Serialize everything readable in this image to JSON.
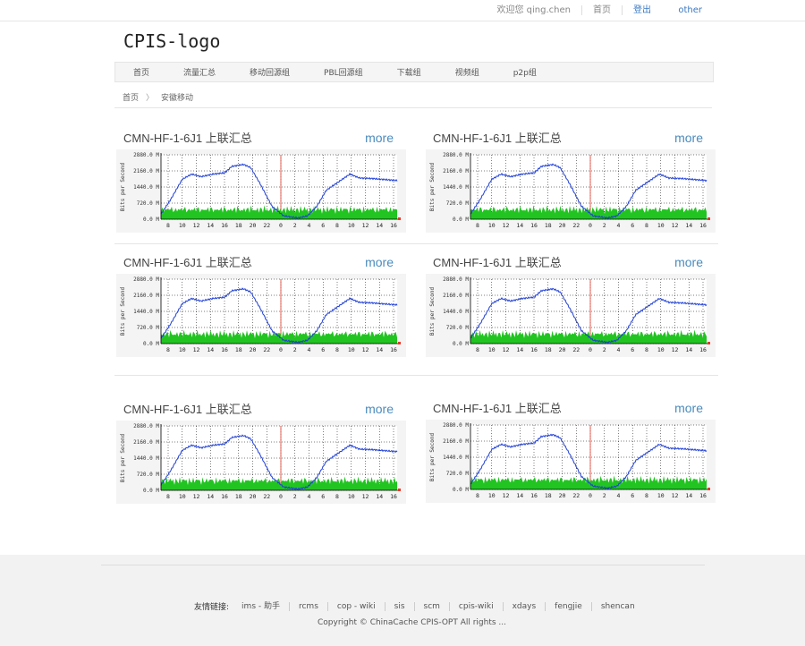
{
  "topbar": {
    "welcome": "欢迎您 qing.chen",
    "home": "首页",
    "logout": "登出",
    "other": "other"
  },
  "logo": "CPIS-logo",
  "nav": [
    "首页",
    "流量汇总",
    "移动回源组",
    "PBL回源组",
    "下载组",
    "视频组",
    "p2p组"
  ],
  "breadcrumb": {
    "home": "首页",
    "sep": "〉",
    "current": "安徽移动"
  },
  "panels": [
    {
      "title": "CMN-HF-1-6J1 上联汇总",
      "more": "more",
      "ytop": "2880.0 M",
      "yticks": [
        "2880.0 M",
        "2160.0 M",
        "1440.0 M",
        "720.0 M",
        "0.0 M"
      ],
      "xticks": [
        "8",
        "10",
        "12",
        "14",
        "16",
        "18",
        "20",
        "22",
        "0",
        "2",
        "4",
        "6",
        "8",
        "10",
        "12",
        "14",
        "16"
      ]
    },
    {
      "title": "CMN-HF-1-6J1 上联汇总",
      "more": "more",
      "yticks": [
        "2880.0 M",
        "2160.0 M",
        "1440.0 M",
        "720.0 M",
        "0.0 M"
      ],
      "xticks": [
        "8",
        "10",
        "12",
        "14",
        "16",
        "18",
        "20",
        "22",
        "0",
        "2",
        "4",
        "6",
        "8",
        "10",
        "12",
        "14",
        "16"
      ]
    },
    {
      "title": "CMN-HF-1-6J1 上联汇总",
      "more": "more",
      "yticks": [
        "2880.0 M",
        "2160.0 M",
        "1440.0 M",
        "720.0 M",
        "0.0 M"
      ],
      "xticks": [
        "8",
        "10",
        "12",
        "14",
        "16",
        "18",
        "20",
        "22",
        "0",
        "2",
        "4",
        "6",
        "8",
        "10",
        "12",
        "14",
        "16"
      ]
    },
    {
      "title": "CMN-HF-1-6J1 上联汇总",
      "more": "more",
      "yticks": [
        "2880.0 M",
        "2160.0 M",
        "1440.0 M",
        "720.0 M",
        "0.0 M"
      ],
      "xticks": [
        "8",
        "10",
        "12",
        "14",
        "16",
        "18",
        "20",
        "22",
        "0",
        "2",
        "4",
        "6",
        "8",
        "10",
        "12",
        "14",
        "16"
      ]
    },
    {
      "title": "CMN-HF-1-6J1 上联汇总",
      "more": "more",
      "yticks": [
        "2880.0 M",
        "2160.0 M",
        "1440.0 M",
        "720.0 M",
        "0.0 M"
      ],
      "xticks": [
        "8",
        "10",
        "12",
        "14",
        "16",
        "18",
        "20",
        "22",
        "0",
        "2",
        "4",
        "6",
        "8",
        "10",
        "12",
        "14",
        "16"
      ]
    },
    {
      "title": "CMN-HF-1-6J1 上联汇总",
      "more": "more",
      "yticks": [
        "2880.0 M",
        "2160.0 M",
        "1440.0 M",
        "720.0 M",
        "0.0 M"
      ],
      "xticks": [
        "8",
        "10",
        "12",
        "14",
        "16",
        "18",
        "20",
        "22",
        "0",
        "2",
        "4",
        "6",
        "8",
        "10",
        "12",
        "14",
        "16"
      ]
    }
  ],
  "graph_ylabel": "Bits per Second",
  "colors": {
    "line": "#1f3fd6",
    "fill": "#22c422",
    "marker": "#e23a2a",
    "grid": "#000000"
  },
  "footer": {
    "label": "友情链接:",
    "links": [
      "ims - 助手",
      "rcms",
      "cop - wiki",
      "sis",
      "scm",
      "cpis-wiki",
      "xdays",
      "fengjie",
      "shencan"
    ],
    "copyright": "Copyright © ChinaCache CPIS-OPT All rights ..."
  }
}
